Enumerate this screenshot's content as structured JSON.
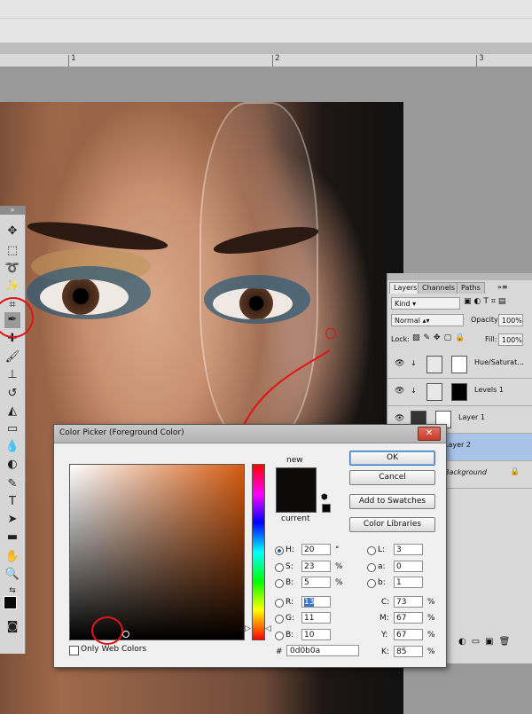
{
  "ruler": {
    "marks": [
      "1",
      "2",
      "3"
    ]
  },
  "toolbox": {
    "header": "»",
    "tools": [
      {
        "name": "move-tool-icon",
        "glyph": "✥"
      },
      {
        "name": "marquee-tool-icon",
        "glyph": "⬚"
      },
      {
        "name": "lasso-tool-icon",
        "glyph": "➰"
      },
      {
        "name": "magic-wand-tool-icon",
        "glyph": "✨"
      },
      {
        "name": "crop-tool-icon",
        "glyph": "⌗"
      },
      {
        "name": "eyedropper-tool-icon",
        "glyph": "✒"
      },
      {
        "name": "healing-brush-tool-icon",
        "glyph": "✚"
      },
      {
        "name": "brush-tool-icon",
        "glyph": "🖌"
      },
      {
        "name": "clone-stamp-tool-icon",
        "glyph": "⊥"
      },
      {
        "name": "history-brush-tool-icon",
        "glyph": "↺"
      },
      {
        "name": "eraser-tool-icon",
        "glyph": "◭"
      },
      {
        "name": "gradient-tool-icon",
        "glyph": "▭"
      },
      {
        "name": "blur-tool-icon",
        "glyph": "💧"
      },
      {
        "name": "dodge-tool-icon",
        "glyph": "◐"
      },
      {
        "name": "pen-tool-icon",
        "glyph": "✎"
      },
      {
        "name": "type-tool-icon",
        "glyph": "T"
      },
      {
        "name": "path-selection-tool-icon",
        "glyph": "➤"
      },
      {
        "name": "shape-tool-icon",
        "glyph": "▬"
      },
      {
        "name": "hand-tool-icon",
        "glyph": "✋"
      },
      {
        "name": "zoom-tool-icon",
        "glyph": "🔍"
      },
      {
        "name": "default-colors-icon",
        "glyph": "⇆"
      },
      {
        "name": "quick-mask-icon",
        "glyph": "◙"
      }
    ]
  },
  "layers_panel": {
    "tabs": [
      "Layers",
      "Channels",
      "Paths"
    ],
    "kind_filter": "Kind",
    "blend_mode": "Normal",
    "opacity_label": "Opacity:",
    "opacity_value": "100%",
    "lock_label": "Lock:",
    "fill_label": "Fill:",
    "fill_value": "100%",
    "layers": [
      {
        "name": "Hue/Saturat...",
        "selected": false
      },
      {
        "name": "Levels 1",
        "selected": false
      },
      {
        "name": "Layer 1",
        "selected": false
      },
      {
        "name": "Layer 2",
        "selected": true
      },
      {
        "name": "Background",
        "selected": false
      }
    ]
  },
  "color_picker": {
    "title": "Color Picker (Foreground Color)",
    "close_glyph": "✕",
    "new_label": "new",
    "current_label": "current",
    "buttons": {
      "ok": "OK",
      "cancel": "Cancel",
      "add_to_swatches": "Add to Swatches",
      "color_libraries": "Color Libraries"
    },
    "only_web_colors": "Only Web Colors",
    "fields": {
      "H": {
        "label": "H:",
        "value": "20",
        "unit": "°"
      },
      "S": {
        "label": "S:",
        "value": "23",
        "unit": "%"
      },
      "B": {
        "label": "B:",
        "value": "5",
        "unit": "%"
      },
      "R": {
        "label": "R:",
        "value": "13",
        "unit": ""
      },
      "G": {
        "label": "G:",
        "value": "11",
        "unit": ""
      },
      "Bl": {
        "label": "B:",
        "value": "10",
        "unit": ""
      },
      "L": {
        "label": "L:",
        "value": "3",
        "unit": ""
      },
      "a": {
        "label": "a:",
        "value": "0",
        "unit": ""
      },
      "b": {
        "label": "b:",
        "value": "1",
        "unit": ""
      },
      "C": {
        "label": "C:",
        "value": "73",
        "unit": "%"
      },
      "M": {
        "label": "M:",
        "value": "67",
        "unit": "%"
      },
      "Y": {
        "label": "Y:",
        "value": "67",
        "unit": "%"
      },
      "K": {
        "label": "K:",
        "value": "85",
        "unit": "%"
      }
    },
    "hex_label": "#",
    "hex_value": "0d0b0a",
    "swatch_color": "#0d0b0a"
  },
  "colors": {
    "annotation_red": "#e01515",
    "selection_blue": "#a8c2e8"
  }
}
